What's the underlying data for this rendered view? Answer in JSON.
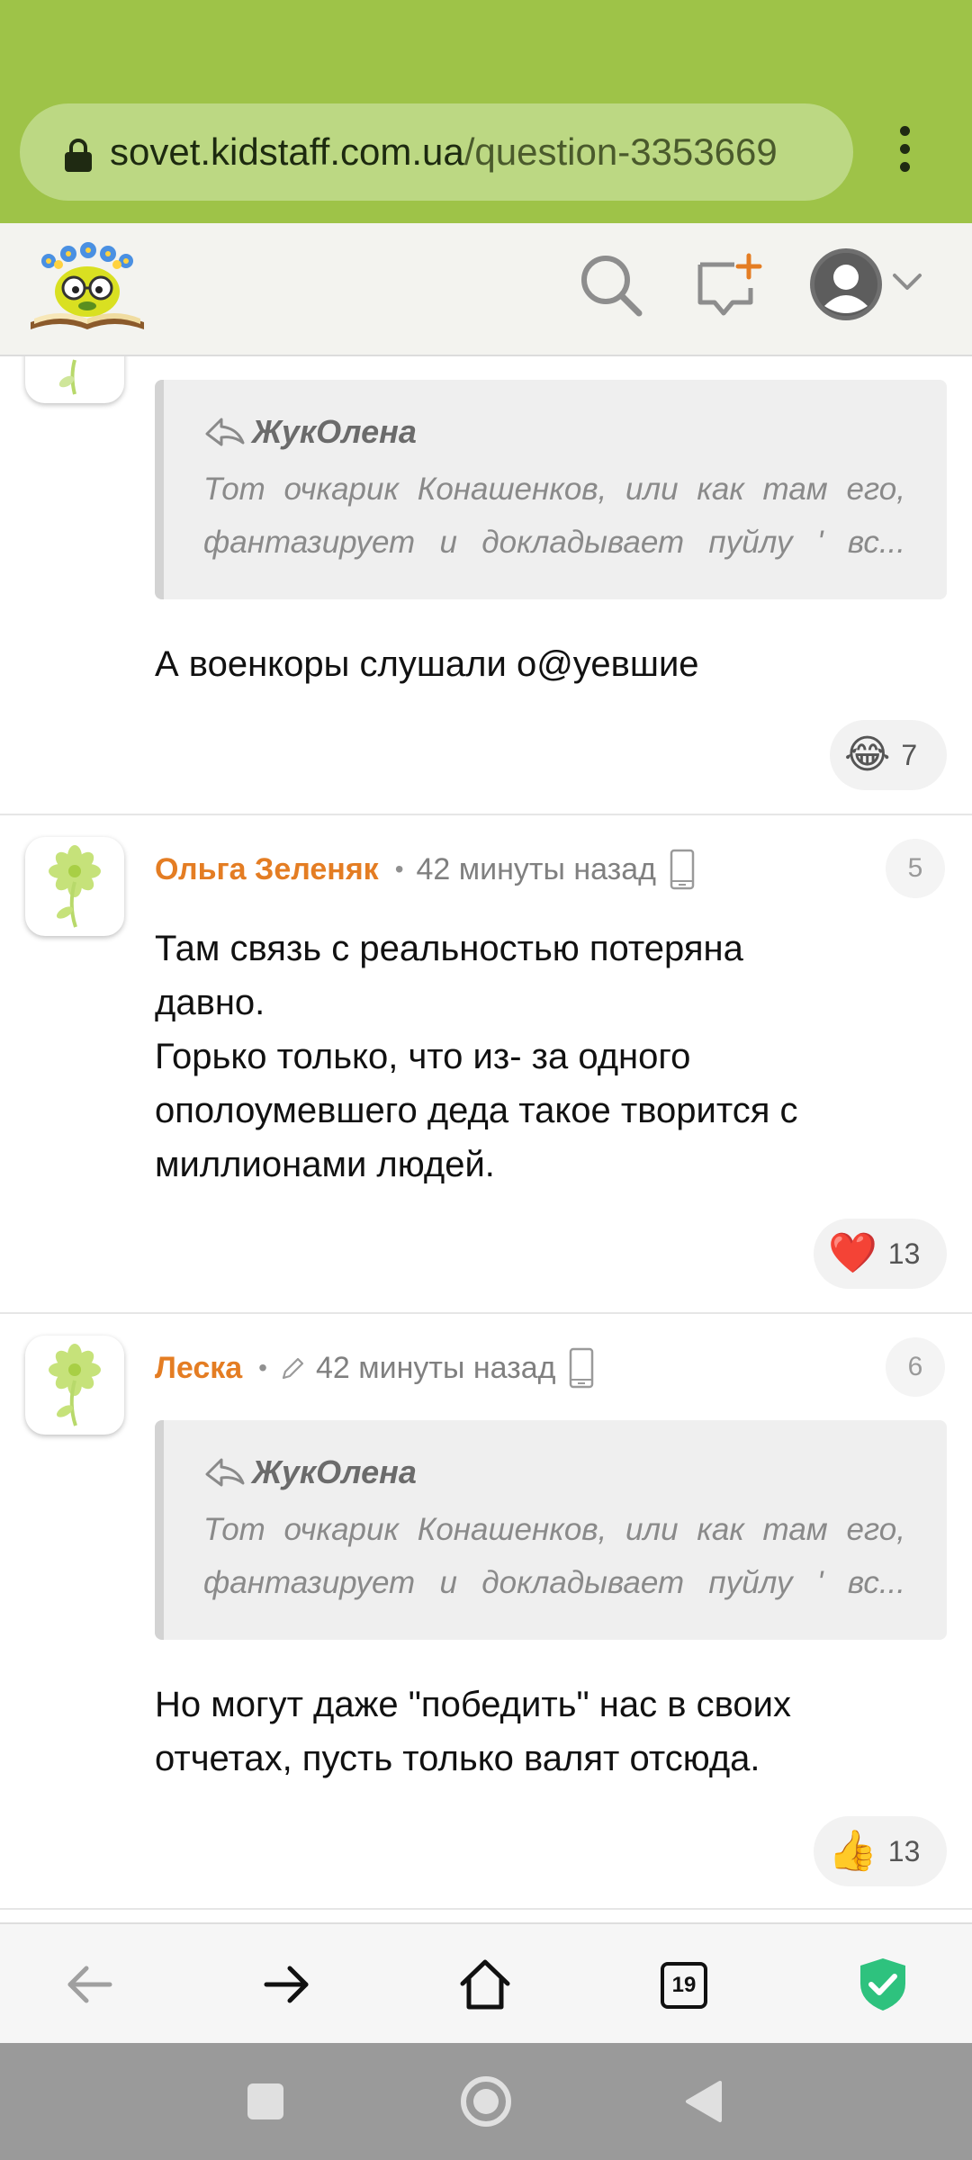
{
  "browser": {
    "url_domain": "sovet.kidstaff.com.ua",
    "url_path": "/question-3353669",
    "tab_count": "19"
  },
  "comments": [
    {
      "quote": {
        "author": "ЖукОлена",
        "text": "Тот очкарик Конашенков, или как там его, фантазирует и докладывает пуйлу ' вс..."
      },
      "text": "А военкоры слушали о@уевшие",
      "reaction": {
        "emoji": "😂",
        "count": "7"
      }
    },
    {
      "author": "Ольга Зеленяк",
      "time": "42 минуты назад",
      "number": "5",
      "text_lines": [
        "Там связь с реальностью потеряна",
        "давно.",
        "Горько только, что из- за одного",
        "ополоумевшего деда такое творится с",
        "миллионами людей."
      ],
      "reaction": {
        "emoji": "❤️",
        "count": "13"
      }
    },
    {
      "author": "Леска",
      "time": "42 минуты назад",
      "number": "6",
      "edited": true,
      "quote": {
        "author": "ЖукОлена",
        "text": "Тот очкарик Конашенков, или как там его, фантазирует и докладывает пуйлу ' вс..."
      },
      "text_lines": [
        "Но могут даже \"победить\" нас в своих",
        "отчетах, пусть только валят отсюда."
      ],
      "reaction": {
        "emoji": "👍",
        "count": "13"
      }
    }
  ],
  "colors": {
    "browser_bar": "#9ec348",
    "author": "#e47d23",
    "shield": "#2ec27e"
  }
}
